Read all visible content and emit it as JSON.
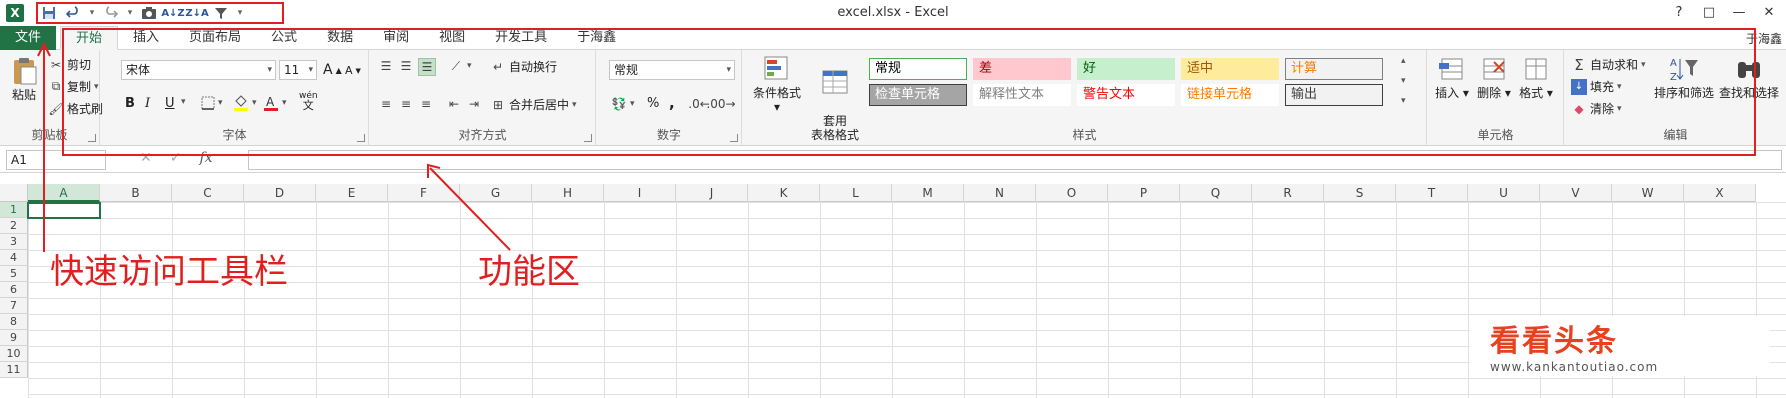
{
  "window": {
    "title": "excel.xlsx - Excel",
    "app_icon": "X",
    "help": "?",
    "restore": "□",
    "minimize": "—",
    "close": "✕"
  },
  "qat": {
    "icons": [
      "save-icon",
      "undo-icon",
      "redo-icon",
      "camera-icon",
      "sort-asc-icon",
      "sort-desc-icon",
      "filter-icon",
      "customize-icon"
    ]
  },
  "tabs": {
    "file": "文件",
    "items": [
      "开始",
      "插入",
      "页面布局",
      "公式",
      "数据",
      "审阅",
      "视图",
      "开发工具",
      "于海鑫"
    ],
    "active": 0,
    "user": "于海鑫"
  },
  "ribbon": {
    "clipboard": {
      "label": "剪贴板",
      "paste": "粘贴",
      "cut": "剪切",
      "copy": "复制",
      "painter": "格式刷"
    },
    "font": {
      "label": "字体",
      "name": "宋体",
      "size": "11",
      "bold": "B",
      "italic": "I",
      "underline": "U",
      "wen": "wén",
      "grow": "A",
      "shrink": "A"
    },
    "alignment": {
      "label": "对齐方式",
      "wrap": "自动换行",
      "merge": "合并后居中"
    },
    "number": {
      "label": "数字",
      "format": "常规",
      "percent": "%",
      "comma": ","
    },
    "styles": {
      "label": "样式",
      "cond": "条件格式",
      "table": "套用\n表格格式",
      "cells": [
        {
          "text": "常规",
          "bg": "#ffffff",
          "color": "#000000",
          "border": "#4caf50"
        },
        {
          "text": "差",
          "bg": "#ffc7ce",
          "color": "#9c0006",
          "border": "#ffc7ce"
        },
        {
          "text": "好",
          "bg": "#c6efce",
          "color": "#006100",
          "border": "#c6efce"
        },
        {
          "text": "适中",
          "bg": "#ffeb9c",
          "color": "#9c5700",
          "border": "#ffeb9c"
        },
        {
          "text": "计算",
          "bg": "#f2f2f2",
          "color": "#fa7d00",
          "border": "#7f7f7f"
        },
        {
          "text": "检查单元格",
          "bg": "#a5a5a5",
          "color": "#ffffff",
          "border": "#3f3f3f"
        },
        {
          "text": "解释性文本",
          "bg": "#ffffff",
          "color": "#7f7f7f",
          "border": "#ffffff"
        },
        {
          "text": "警告文本",
          "bg": "#ffffff",
          "color": "#ff0000",
          "border": "#ffffff"
        },
        {
          "text": "链接单元格",
          "bg": "#ffffff",
          "color": "#fa7d00",
          "border": "#ffffff"
        },
        {
          "text": "输出",
          "bg": "#f2f2f2",
          "color": "#3f3f3f",
          "border": "#3f3f3f"
        }
      ]
    },
    "cells": {
      "label": "单元格",
      "insert": "插入",
      "delete": "删除",
      "format": "格式"
    },
    "editing": {
      "label": "编辑",
      "autosum": "自动求和",
      "fill": "填充",
      "clear": "清除",
      "sort": "排序和筛选",
      "find": "查找和选择"
    }
  },
  "formula_bar": {
    "name_box": "A1",
    "cancel": "✕",
    "enter": "✓",
    "fx": "fx",
    "value": ""
  },
  "grid": {
    "columns": [
      "A",
      "B",
      "C",
      "D",
      "E",
      "F",
      "G",
      "H",
      "I",
      "J",
      "K",
      "L",
      "M",
      "N",
      "O",
      "P",
      "Q",
      "R",
      "S",
      "T",
      "U",
      "V",
      "W",
      "X"
    ],
    "rows": [
      "1",
      "2",
      "3",
      "4",
      "5",
      "6",
      "7",
      "8",
      "9",
      "10",
      "11"
    ],
    "selected": "A1"
  },
  "annotations": {
    "qat_label": "快速访问工具栏",
    "ribbon_label": "功能区",
    "color": "#e02020"
  },
  "watermark": {
    "title": "看看头条",
    "url": "www.kankantoutiao.com"
  }
}
